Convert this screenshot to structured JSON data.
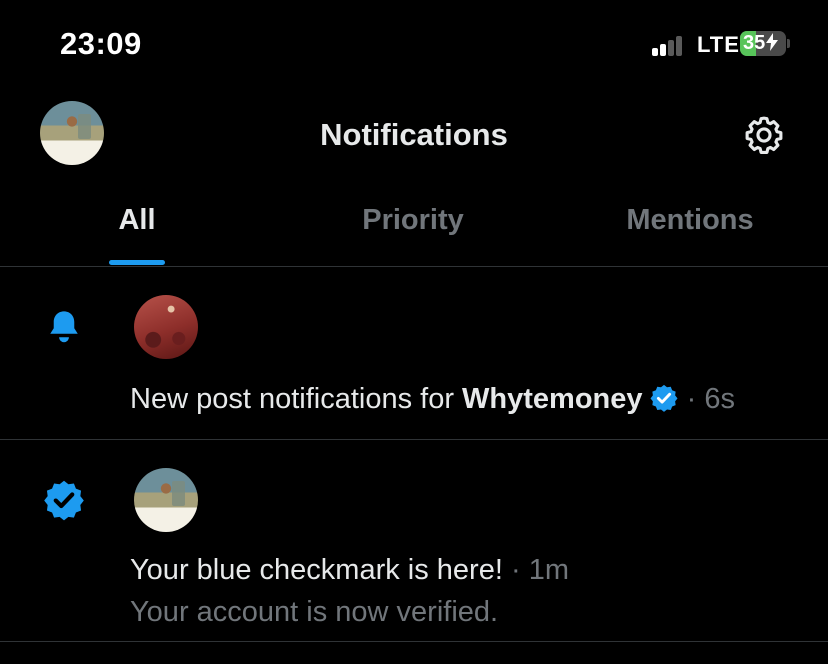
{
  "status_bar": {
    "time": "23:09",
    "network": "LTE",
    "battery_percent": "35",
    "battery_level": 0.35,
    "colors": {
      "battery": "#58c45a"
    }
  },
  "header": {
    "title": "Notifications",
    "settings_icon": "gear-icon"
  },
  "tabs": [
    {
      "label": "All",
      "active": true
    },
    {
      "label": "Priority",
      "active": false
    },
    {
      "label": "Mentions",
      "active": false
    }
  ],
  "notifications": [
    {
      "icon": "bell-icon",
      "text_prefix": "New post notifications for ",
      "user": "Whytemoney",
      "verified": true,
      "time": "6s",
      "separator": " · "
    },
    {
      "icon": "verified-badge-icon",
      "title": "Your blue checkmark is here!",
      "time": "1m",
      "separator": " · ",
      "subtitle": "Your account is now verified."
    }
  ],
  "colors": {
    "accent": "#1d9bf0",
    "background": "#000000",
    "text": "#e7e9ea",
    "muted": "#71767b",
    "divider": "#2f3336"
  }
}
